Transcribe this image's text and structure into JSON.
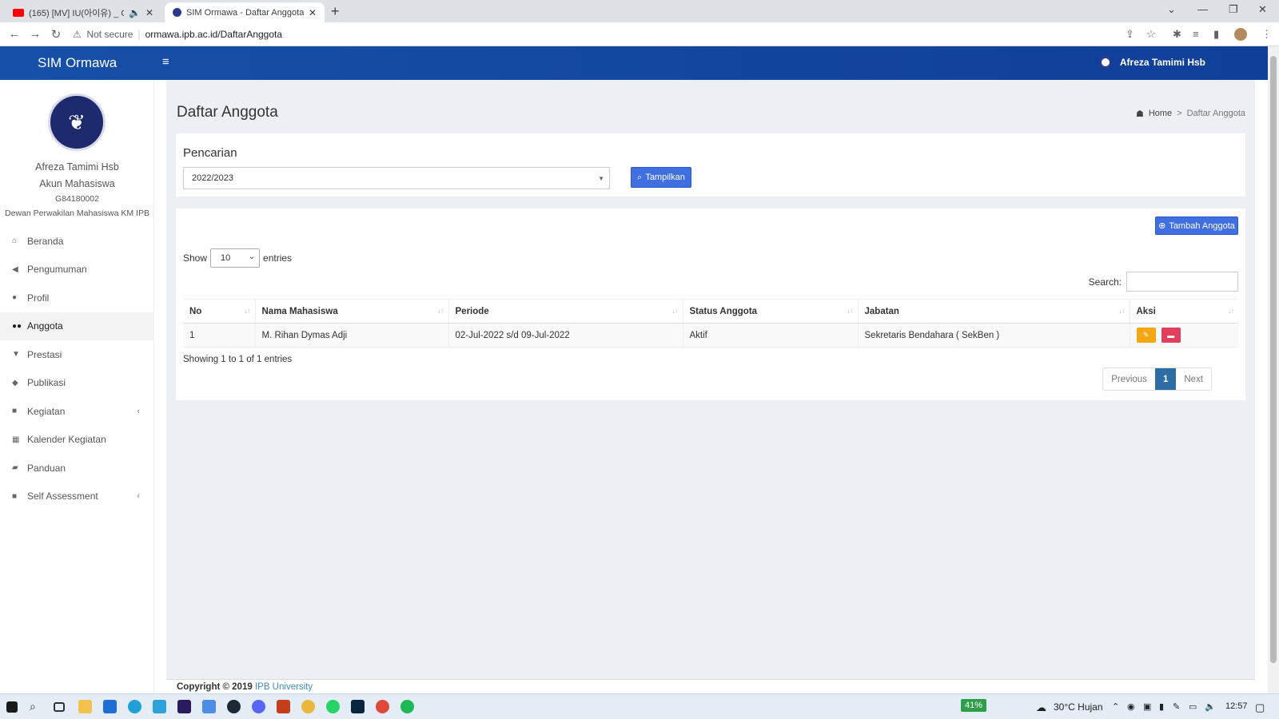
{
  "browser": {
    "tabs": [
      {
        "title": "(165) [MV] IU(아이유) _ Celeb",
        "active": false
      },
      {
        "title": "SIM Ormawa - Daftar Anggota",
        "active": true
      }
    ],
    "security": "Not secure",
    "url": "ormawa.ipb.ac.id/DaftarAnggota"
  },
  "header": {
    "brand": "SIM Ormawa",
    "user": "Afreza Tamimi Hsb"
  },
  "sidebar": {
    "name": "Afreza Tamimi Hsb",
    "role": "Akun Mahasiswa",
    "nim": "G84180002",
    "org": "Dewan Perwakilan Mahasiswa KM IPB",
    "items": [
      {
        "label": "Beranda",
        "icon": "home-icon"
      },
      {
        "label": "Pengumuman",
        "icon": "bullhorn-icon"
      },
      {
        "label": "Profil",
        "icon": "user-icon"
      },
      {
        "label": "Anggota",
        "icon": "users-icon",
        "active": true
      },
      {
        "label": "Prestasi",
        "icon": "trophy-icon"
      },
      {
        "label": "Publikasi",
        "icon": "comments-icon"
      },
      {
        "label": "Kegiatan",
        "icon": "folder-icon",
        "expandable": true
      },
      {
        "label": "Kalender Kegiatan",
        "icon": "calendar-icon"
      },
      {
        "label": "Panduan",
        "icon": "book-icon"
      },
      {
        "label": "Self Assessment",
        "icon": "folder-icon",
        "expandable": true
      }
    ]
  },
  "page": {
    "title": "Daftar Anggota",
    "breadcrumb": {
      "home": "Home",
      "current": "Daftar Anggota"
    }
  },
  "search_box": {
    "title": "Pencarian",
    "year": "2022/2023",
    "button": "Tampilkan"
  },
  "table_box": {
    "add_button": "Tambah Anggota",
    "show_label": "Show",
    "entries_value": "10",
    "entries_label": "entries",
    "search_label": "Search:",
    "columns": [
      "No",
      "Nama Mahasiswa",
      "Periode",
      "Status Anggota",
      "Jabatan",
      "Aksi"
    ],
    "rows": [
      {
        "no": "1",
        "nama": "M. Rihan Dymas Adji",
        "periode": "02-Jul-2022 s/d 09-Jul-2022",
        "status": "Aktif",
        "jabatan": "Sekretaris Bendahara ( SekBen )"
      }
    ],
    "info": "Showing 1 to 1 of 1 entries",
    "pager": {
      "prev": "Previous",
      "current": "1",
      "next": "Next"
    }
  },
  "footer": {
    "text": "Copyright © 2019",
    "link": "IPB University"
  },
  "taskbar": {
    "battery": "41%",
    "weather": "30°C  Hujan",
    "time": "12:57"
  },
  "colors": {
    "header": "#1750a8",
    "primary_button": "#3f6fe0",
    "edit": "#f3a712",
    "delete": "#e03e5c"
  }
}
